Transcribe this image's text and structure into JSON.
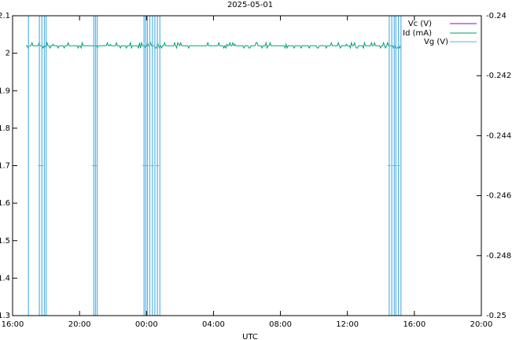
{
  "chart_data": {
    "type": "line",
    "title": "2025-05-01",
    "xlabel": "UTC",
    "ylabel": "",
    "y2label": "",
    "x_range_hours": [
      16,
      44
    ],
    "xlim": [
      "16:00",
      "20:00"
    ],
    "xticks": [
      "16:00",
      "20:00",
      "00:00",
      "04:00",
      "08:00",
      "12:00",
      "16:00",
      "20:00"
    ],
    "ylim": [
      1.3,
      2.1
    ],
    "yticks": [
      "1.3",
      "1.4",
      "1.5",
      "1.6",
      "1.7",
      "1.8",
      "1.9",
      "2",
      "2.1"
    ],
    "y2lim": [
      -0.25,
      -0.24
    ],
    "y2ticks": [
      "-0.25",
      "-0.248",
      "-0.246",
      "-0.244",
      "-0.242",
      "-0.24"
    ],
    "grid": false,
    "legend_position": "top-right",
    "series": [
      {
        "name": "Vc (V)",
        "color": "#9400d3",
        "axis": "y"
      },
      {
        "name": "Id (mA)",
        "color": "#009e73",
        "axis": "y",
        "baseline": 2.02,
        "x_start": 16.8,
        "x_end": 39.2
      },
      {
        "name": "Vg (V)",
        "color": "#56b4e9",
        "axis": "y",
        "dropouts": [
          16.95,
          17.6,
          17.75,
          17.9,
          18.0,
          20.85,
          20.95,
          21.05,
          23.85,
          23.95,
          24.05,
          24.2,
          24.35,
          24.5,
          24.65,
          24.8,
          38.5,
          38.65,
          38.8,
          38.9,
          39.05,
          39.2
        ]
      }
    ]
  }
}
